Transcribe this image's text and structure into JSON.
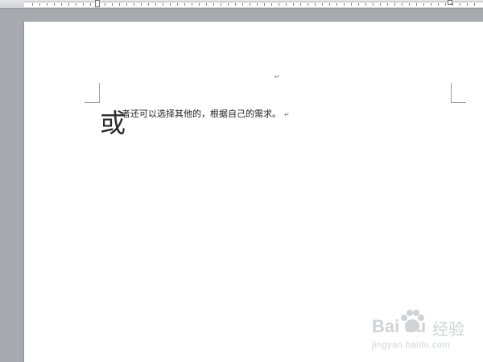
{
  "document": {
    "first_char": "或",
    "line_rest": "者还可以选择其他的，根据自己的需求。",
    "paragraph_mark": "↵"
  },
  "watermark": {
    "logo": "Bai du",
    "experience": "经验",
    "url": "jingyan.baidu.com"
  },
  "colors": {
    "workspace": "#a6a9ae",
    "page": "#ffffff",
    "text": "#1e1e1e",
    "watermark": "#cfd3d8"
  }
}
